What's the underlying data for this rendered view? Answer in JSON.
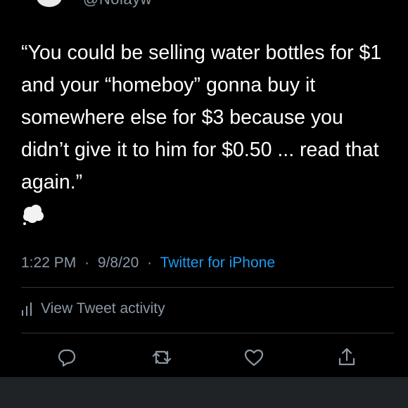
{
  "tweet": {
    "handle": "@Nolayw",
    "text": "“You could be selling water bottles for $1 and your “homeboy” gonna buy it somewhere else for $3 because you didn’t give it to him for $0.50 ... read that again.”",
    "time": "1:22 PM",
    "separator": "·",
    "date": "9/8/20",
    "source": "Twitter for iPhone"
  },
  "activity": {
    "label": "View Tweet activity"
  },
  "actions": {
    "reply_icon": "reply-icon",
    "retweet_icon": "retweet-icon",
    "like_icon": "heart-icon",
    "share_icon": "share-icon"
  },
  "colors": {
    "background": "#000000",
    "text": "#ffffff",
    "muted": "#8b98a5",
    "link": "#1d9bf0",
    "divider": "#2f3336"
  }
}
